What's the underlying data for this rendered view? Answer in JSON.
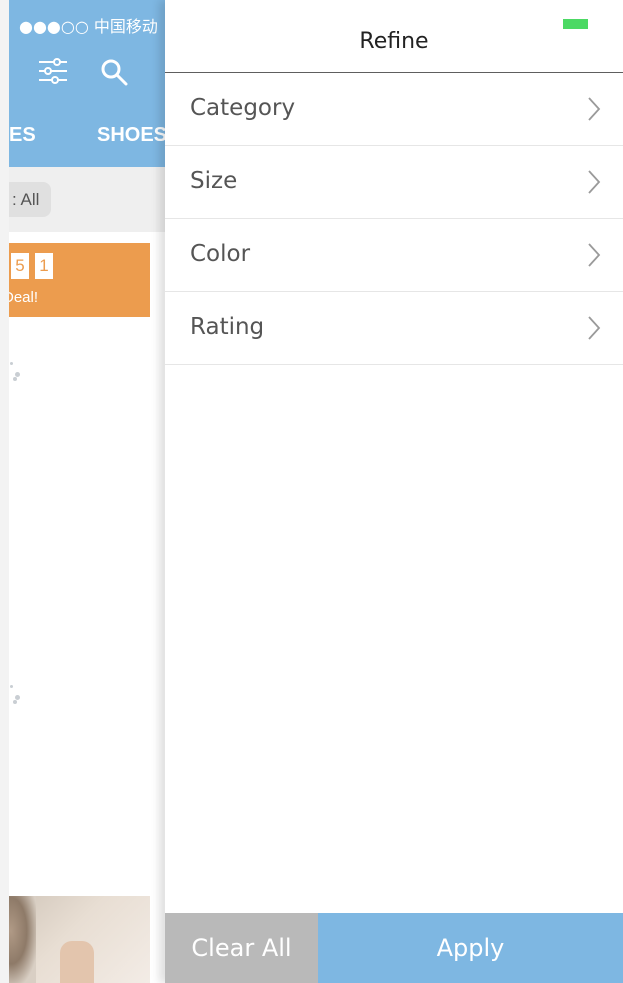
{
  "status_bar": {
    "carrier": "●●●○○ 中国移动",
    "battery_color": "#4cd964"
  },
  "background_app": {
    "header_color": "#7eb7e2",
    "icons": [
      "filter-sliders-icon",
      "search-icon"
    ],
    "tabs": [
      "ES",
      "SHOES"
    ],
    "filter_chip": ": All",
    "deal": {
      "digits": [
        "5",
        "1"
      ],
      "text": "Deal!",
      "color": "#ec9c4e"
    }
  },
  "drawer": {
    "title": "Refine",
    "options": [
      {
        "label": "Category",
        "icon": "chevron-right-icon"
      },
      {
        "label": "Size",
        "icon": "chevron-right-icon"
      },
      {
        "label": "Color",
        "icon": "chevron-right-icon"
      },
      {
        "label": "Rating",
        "icon": "chevron-right-icon"
      }
    ],
    "buttons": {
      "clear_all": "Clear All",
      "apply": "Apply"
    },
    "colors": {
      "clear_button": "#b9b9b9",
      "apply_button": "#7eb7e2"
    }
  }
}
